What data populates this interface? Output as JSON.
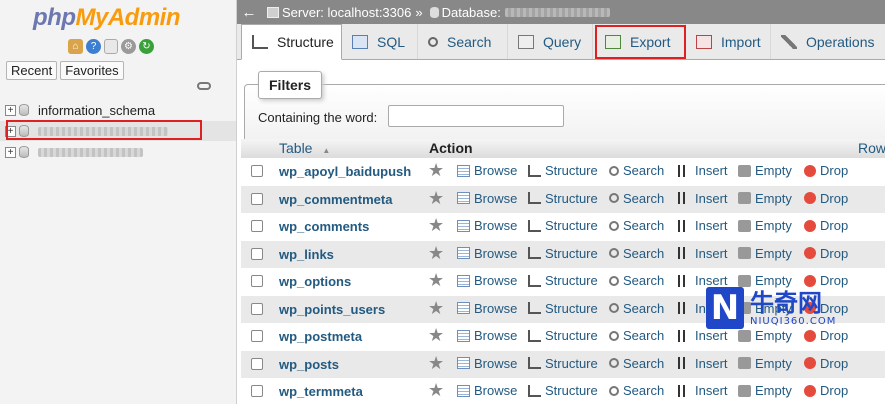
{
  "nav": {
    "logo_php": "php",
    "logo_myadmin": "MyAdmin",
    "icons": [
      "home-icon",
      "help-icon",
      "docs-icon",
      "settings-icon",
      "reload-icon"
    ],
    "tabs": [
      "Recent",
      "Favorites"
    ],
    "databases": [
      {
        "name": "information_schema",
        "expander": "+"
      },
      {
        "name": "",
        "expander": "+",
        "blurred": true
      },
      {
        "name": "",
        "expander": "+",
        "blurred": true
      }
    ]
  },
  "breadcrumb": {
    "server": "Server: localhost:3306",
    "separator": "»",
    "database": "Database:"
  },
  "tabs": [
    "Structure",
    "SQL",
    "Search",
    "Query",
    "Export",
    "Import",
    "Operations"
  ],
  "active_tab": "Structure",
  "highlighted_tab": "Export",
  "filters": {
    "legend": "Filters",
    "label": "Containing the word:",
    "value": ""
  },
  "table": {
    "headers": {
      "table": "Table",
      "sort_indicator": "▲",
      "action": "Action",
      "rows": "Row"
    },
    "actions": [
      "Browse",
      "Structure",
      "Search",
      "Insert",
      "Empty",
      "Drop"
    ],
    "rows": [
      "wp_apoyl_baidupush",
      "wp_commentmeta",
      "wp_comments",
      "wp_links",
      "wp_options",
      "wp_points_users",
      "wp_postmeta",
      "wp_posts",
      "wp_termmeta"
    ]
  },
  "watermark": {
    "letter": "N",
    "cn": "牛奇网",
    "en": "NIUQI360.COM"
  },
  "colors": {
    "link": "#235a81",
    "highlight": "#e02020",
    "topbar": "#888888"
  }
}
